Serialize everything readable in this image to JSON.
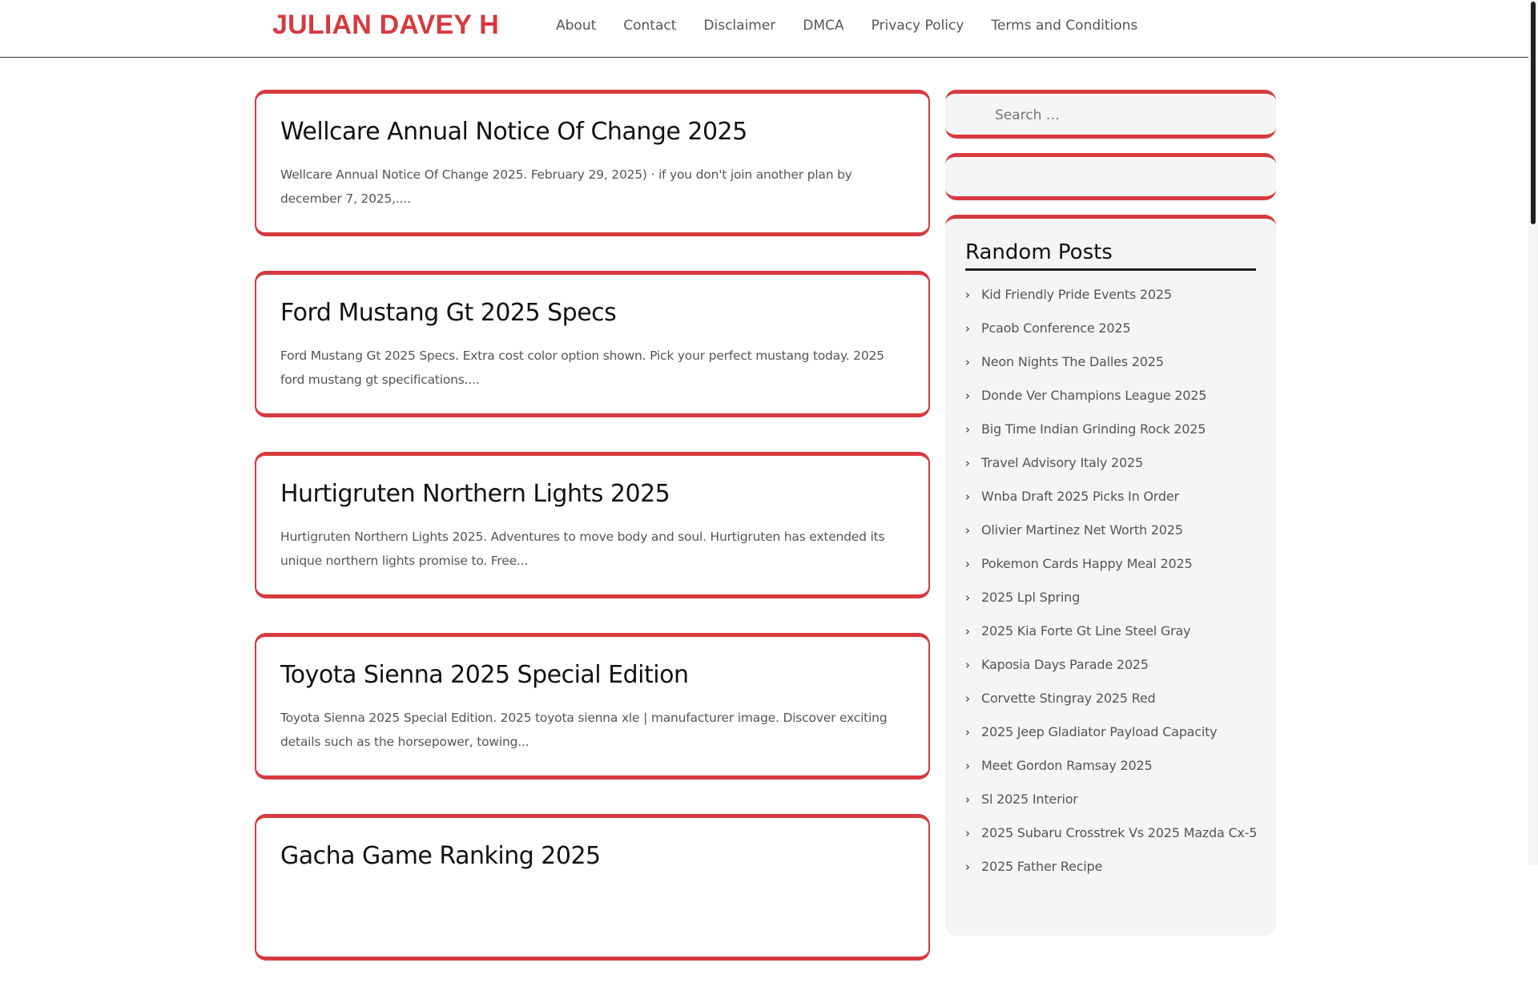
{
  "site": {
    "title": "JULIAN DAVEY H",
    "colors": {
      "accent": "#d63a3f",
      "text": "#222222",
      "muted": "#555555",
      "widget_bg": "#f5f5f5"
    }
  },
  "nav": {
    "items": [
      "About",
      "Contact",
      "Disclaimer",
      "DMCA",
      "Privacy Policy",
      "Terms and Conditions"
    ]
  },
  "posts": [
    {
      "title": "Wellcare Annual Notice Of Change 2025",
      "excerpt": "Wellcare Annual Notice Of Change 2025. February 29, 2025) · if you don't join another plan by december 7, 2025,...."
    },
    {
      "title": "Ford Mustang Gt 2025 Specs",
      "excerpt": "Ford Mustang Gt 2025 Specs. Extra cost color option shown. Pick your perfect mustang today. 2025 ford mustang gt specifications...."
    },
    {
      "title": "Hurtigruten Northern Lights 2025",
      "excerpt": "Hurtigruten Northern Lights 2025. Adventures to move body and soul. Hurtigruten has extended its unique northern lights promise to. Free..."
    },
    {
      "title": "Toyota Sienna 2025 Special Edition",
      "excerpt": "Toyota Sienna 2025 Special Edition. 2025 toyota sienna xle | manufacturer image. Discover exciting details such as the horsepower, towing..."
    },
    {
      "title": "Gacha Game Ranking 2025",
      "excerpt": ""
    }
  ],
  "sidebar": {
    "search": {
      "placeholder": "Search …"
    },
    "random_posts": {
      "title": "Random Posts",
      "chevron_icon": "chevron-right-icon",
      "items": [
        "Kid Friendly Pride Events 2025",
        "Pcaob Conference 2025",
        "Neon Nights The Dalles 2025",
        "Donde Ver Champions League 2025",
        "Big Time Indian Grinding Rock 2025",
        "Travel Advisory Italy 2025",
        "Wnba Draft 2025 Picks In Order",
        "Olivier Martinez Net Worth 2025",
        "Pokemon Cards Happy Meal 2025",
        "2025 Lpl Spring",
        "2025 Kia Forte Gt Line Steel Gray",
        "Kaposia Days Parade 2025",
        "Corvette Stingray 2025 Red",
        "2025 Jeep Gladiator Payload Capacity",
        "Meet Gordon Ramsay 2025",
        "Sl 2025 Interior",
        "2025 Subaru Crosstrek Vs 2025 Mazda Cx-5",
        "2025 Father Recipe"
      ]
    }
  }
}
